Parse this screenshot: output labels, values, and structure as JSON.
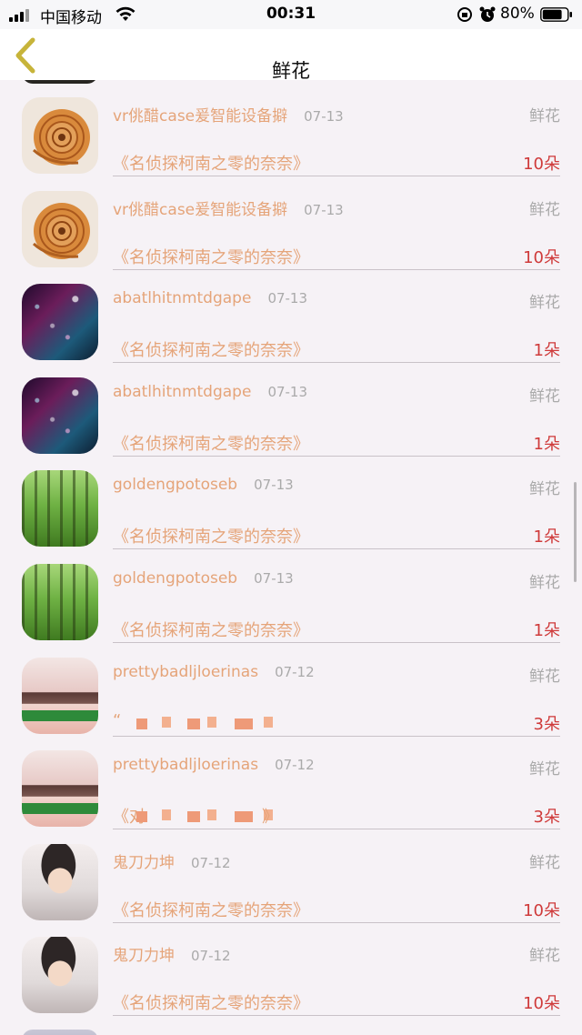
{
  "status_bar": {
    "carrier": "中国移动",
    "time": "00:31",
    "battery_percent": "80%",
    "battery_level": 0.8
  },
  "header": {
    "title": "鲜花"
  },
  "icons": {
    "back": "chevron-left-icon",
    "signal": "signal-icon",
    "wifi": "wifi-icon",
    "orientation_lock": "orientation-lock-icon",
    "alarm": "alarm-icon",
    "battery": "battery-icon"
  },
  "colors": {
    "accent": "#e5a479",
    "amount": "#cf3a3a",
    "back_icon": "#c7b43a"
  },
  "records": [
    {
      "name": "vr佻醋case爰智能设备擗",
      "date": "07-13",
      "category": "鲜花",
      "subtitle": "《名侦探柯南之零的奈奈》",
      "amount": "10朵",
      "avatar": "shell"
    },
    {
      "name": "vr佻醋case爰智能设备擗",
      "date": "07-13",
      "category": "鲜花",
      "subtitle": "《名侦探柯南之零的奈奈》",
      "amount": "10朵",
      "avatar": "shell"
    },
    {
      "name": "abatlhitnmtdgape",
      "date": "07-13",
      "category": "鲜花",
      "subtitle": "《名侦探柯南之零的奈奈》",
      "amount": "1朵",
      "avatar": "drops"
    },
    {
      "name": "abatlhitnmtdgape",
      "date": "07-13",
      "category": "鲜花",
      "subtitle": "《名侦探柯南之零的奈奈》",
      "amount": "1朵",
      "avatar": "drops"
    },
    {
      "name": "goldengpotoseb",
      "date": "07-13",
      "category": "鲜花",
      "subtitle": "《名侦探柯南之零的奈奈》",
      "amount": "1朵",
      "avatar": "forest"
    },
    {
      "name": "goldengpotoseb",
      "date": "07-13",
      "category": "鲜花",
      "subtitle": "《名侦探柯南之零的奈奈》",
      "amount": "1朵",
      "avatar": "forest"
    },
    {
      "name": "prettybadljloerinas",
      "date": "07-12",
      "category": "鲜花",
      "subtitle": "“",
      "amount": "3朵",
      "avatar": "girl",
      "redacted": true
    },
    {
      "name": "prettybadljloerinas",
      "date": "07-12",
      "category": "鲜花",
      "subtitle": "《对",
      "subtitle_end": "》",
      "amount": "3朵",
      "avatar": "girl",
      "redacted": true
    },
    {
      "name": "鬼刀力坤",
      "date": "07-12",
      "category": "鲜花",
      "subtitle": "《名侦探柯南之零的奈奈》",
      "amount": "10朵",
      "avatar": "boy"
    },
    {
      "name": "鬼刀力坤",
      "date": "07-12",
      "category": "鲜花",
      "subtitle": "《名侦探柯南之零的奈奈》",
      "amount": "10朵",
      "avatar": "boy"
    }
  ]
}
